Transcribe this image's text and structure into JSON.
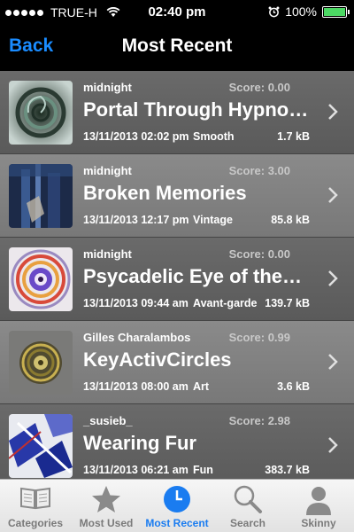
{
  "status": {
    "carrier": "TRUE-H",
    "time": "02:40 pm",
    "battery": "100%"
  },
  "nav": {
    "back_label": "Back",
    "title": "Most Recent"
  },
  "items": [
    {
      "author": "midnight",
      "score": "Score: 0.00",
      "title": "Portal Through Hypnosis",
      "date": "13/11/2013 02:02 pm",
      "style": "Smooth",
      "size": "1.7 kB"
    },
    {
      "author": "midnight",
      "score": "Score: 3.00",
      "title": "Broken Memories",
      "date": "13/11/2013 12:17 pm",
      "style": "Vintage",
      "size": "85.8 kB"
    },
    {
      "author": "midnight",
      "score": "Score: 0.00",
      "title": "Psycadelic Eye of the…",
      "date": "13/11/2013 09:44 am",
      "style": "Avant-garde",
      "size": "139.7 kB"
    },
    {
      "author": "Gilles Charalambos",
      "score": "Score: 0.99",
      "title": "KeyActivCircles",
      "date": "13/11/2013 08:00 am",
      "style": "Art",
      "size": "3.6 kB"
    },
    {
      "author": "_susieb_",
      "score": "Score: 2.98",
      "title": "Wearing Fur",
      "date": "13/11/2013 06:21 am",
      "style": "Fun",
      "size": "383.7 kB"
    }
  ],
  "tabs": [
    {
      "label": "Categories",
      "icon": "book-icon"
    },
    {
      "label": "Most Used",
      "icon": "star-icon"
    },
    {
      "label": "Most Recent",
      "icon": "clock-icon",
      "active": true
    },
    {
      "label": "Search",
      "icon": "magnifier-icon"
    },
    {
      "label": "Skinny",
      "icon": "person-icon"
    }
  ],
  "colors": {
    "accent": "#1a8cff",
    "battery": "#4cd964",
    "tab_active": "#1a7cf0"
  }
}
